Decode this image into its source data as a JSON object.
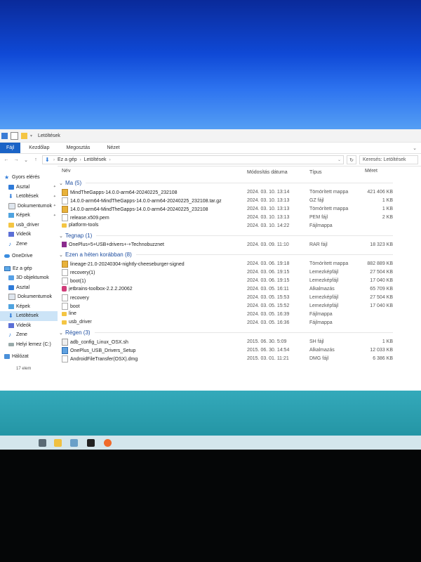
{
  "window": {
    "title": "Letöltések",
    "ribbon_tabs": [
      "Fájl",
      "Kezdőlap",
      "Megosztás",
      "Nézet"
    ]
  },
  "address": {
    "crumbs": [
      "Ez a gép",
      "Letöltések"
    ],
    "search_placeholder": "Keresés: Letöltések"
  },
  "sidebar": {
    "items": [
      {
        "label": "Gyors elérés",
        "icon": "star-icon"
      },
      {
        "label": "Asztal",
        "icon": "desktop-icon"
      },
      {
        "label": "Letöltések",
        "icon": "download-icon"
      },
      {
        "label": "Dokumentumok",
        "icon": "documents-icon"
      },
      {
        "label": "Képek",
        "icon": "pictures-icon"
      },
      {
        "label": "usb_driver",
        "icon": "folder-icon"
      },
      {
        "label": "Videók",
        "icon": "videos-icon"
      },
      {
        "label": "Zene",
        "icon": "music-icon"
      },
      {
        "label": "OneDrive",
        "icon": "cloud-icon"
      },
      {
        "label": "Ez a gép",
        "icon": "pc-icon"
      },
      {
        "label": "3D objektumok",
        "icon": "3d-objects-icon"
      },
      {
        "label": "Asztal",
        "icon": "desktop-icon"
      },
      {
        "label": "Dokumentumok",
        "icon": "documents-icon"
      },
      {
        "label": "Képek",
        "icon": "pictures-icon"
      },
      {
        "label": "Letöltések",
        "icon": "download-icon"
      },
      {
        "label": "Videók",
        "icon": "videos-icon"
      },
      {
        "label": "Zene",
        "icon": "music-icon"
      },
      {
        "label": "Helyi lemez (C:)",
        "icon": "drive-icon"
      },
      {
        "label": "Hálózat",
        "icon": "network-icon"
      }
    ],
    "status": "17 elem"
  },
  "columns": {
    "name": "Név",
    "date": "Módosítás dátuma",
    "type": "Típus",
    "size": "Méret"
  },
  "groups": [
    {
      "label": "Ma (5)",
      "rows": [
        {
          "name": "MindTheGapps-14.0.0-arm64-20240225_232108",
          "date": "2024. 03. 10. 13:14",
          "type": "Tömörített mappa",
          "size": "421 406 KB",
          "icon": "archive-icon"
        },
        {
          "name": "14.0.0-arm64-MindTheGapps-14.0.0-arm64-20240225_232108.tar.gz",
          "date": "2024. 03. 10. 13:13",
          "type": "GZ fájl",
          "size": "1 KB",
          "icon": "file-icon"
        },
        {
          "name": "14.0.0-arm64-MindTheGapps-14.0.0-arm64-20240225_232108",
          "date": "2024. 03. 10. 13:13",
          "type": "Tömörített mappa",
          "size": "1 KB",
          "icon": "archive-icon"
        },
        {
          "name": "release.x509.pem",
          "date": "2024. 03. 10. 13:13",
          "type": "PEM fájl",
          "size": "2 KB",
          "icon": "file-icon"
        },
        {
          "name": "platform-tools",
          "date": "2024. 03. 10. 14:22",
          "type": "Fájlmappa",
          "size": "",
          "icon": "folder-icon"
        }
      ]
    },
    {
      "label": "Tegnap (1)",
      "rows": [
        {
          "name": "OnePlus+5+USB+drivers+-+Technobuzznet",
          "date": "2024. 03. 09. 11:10",
          "type": "RAR fájl",
          "size": "18 323 KB",
          "icon": "rar-icon"
        }
      ]
    },
    {
      "label": "Ezen a héten korábban (8)",
      "rows": [
        {
          "name": "lineage-21.0-20240304-nightly-cheeseburger-signed",
          "date": "2024. 03. 06. 19:18",
          "type": "Tömörített mappa",
          "size": "882 889 KB",
          "icon": "archive-icon"
        },
        {
          "name": "recovery(1)",
          "date": "2024. 03. 06. 19:15",
          "type": "Lemezképfájl",
          "size": "27 504 KB",
          "icon": "file-icon"
        },
        {
          "name": "boot(1)",
          "date": "2024. 03. 06. 19:15",
          "type": "Lemezképfájl",
          "size": "17 040 KB",
          "icon": "file-icon"
        },
        {
          "name": "jetbrains-toolbox-2.2.2.20062",
          "date": "2024. 03. 05. 16:11",
          "type": "Alkalmazás",
          "size": "65 709 KB",
          "icon": "app-icon"
        },
        {
          "name": "recovery",
          "date": "2024. 03. 05. 15:53",
          "type": "Lemezképfájl",
          "size": "27 504 KB",
          "icon": "file-icon"
        },
        {
          "name": "boot",
          "date": "2024. 03. 05. 15:52",
          "type": "Lemezképfájl",
          "size": "17 040 KB",
          "icon": "file-icon"
        },
        {
          "name": "line",
          "date": "2024. 03. 05. 16:39",
          "type": "Fájlmappa",
          "size": "",
          "icon": "folder-icon"
        },
        {
          "name": "usb_driver",
          "date": "2024. 03. 05. 16:36",
          "type": "Fájlmappa",
          "size": "",
          "icon": "folder-icon"
        }
      ]
    },
    {
      "label": "Régen (3)",
      "rows": [
        {
          "name": "adb_config_Linux_OSX.sh",
          "date": "2015. 06. 30. 5:09",
          "type": "SH fájl",
          "size": "1 KB",
          "icon": "script-icon"
        },
        {
          "name": "OnePlus_USB_Drivers_Setup",
          "date": "2015. 06. 30. 14:54",
          "type": "Alkalmazás",
          "size": "12 033 KB",
          "icon": "setup-icon"
        },
        {
          "name": "AndroidFileTransfer(OSX).dmg",
          "date": "2015. 03. 01. 11:21",
          "type": "DMG fájl",
          "size": "6 386 KB",
          "icon": "file-icon"
        }
      ]
    }
  ],
  "colors": {
    "accent": "#1a63c6",
    "group_header": "#1e4ea0",
    "selection": "#cce4f7"
  }
}
